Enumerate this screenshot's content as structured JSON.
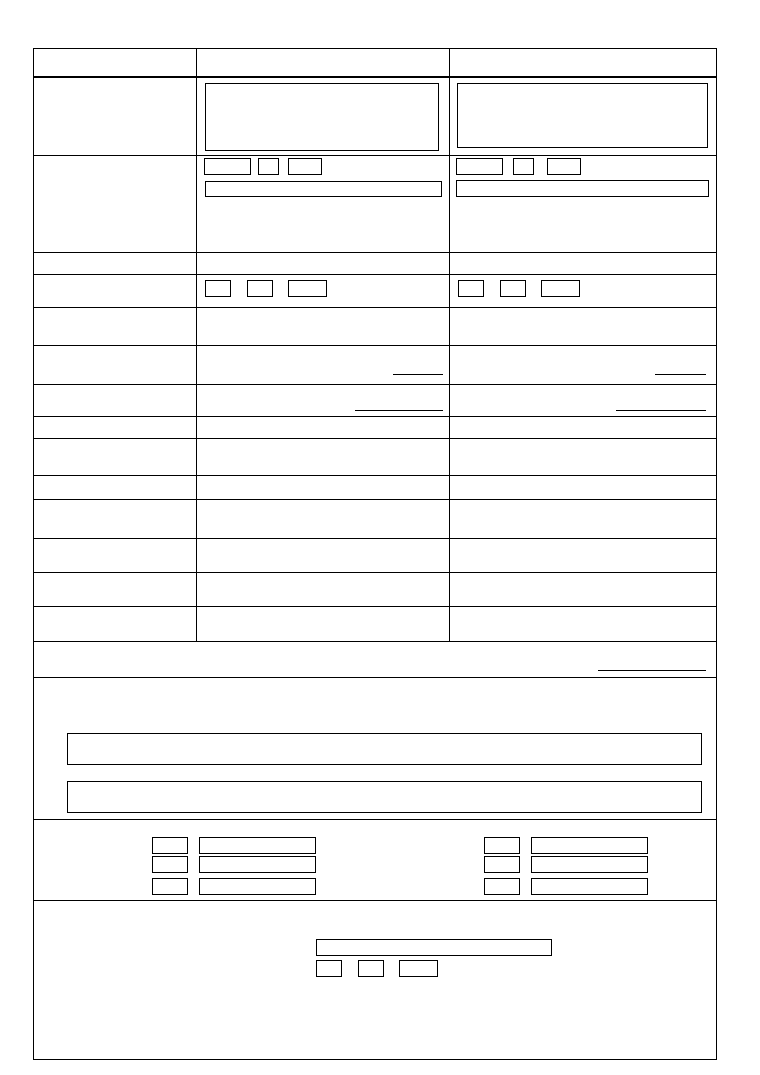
{
  "form": {
    "header": {
      "label_col": "",
      "col_a": "",
      "col_b": ""
    },
    "rows": [
      {
        "label": "",
        "value_a": "",
        "value_b": ""
      },
      {
        "label": "",
        "value_a": "",
        "value_b": ""
      },
      {
        "label": "",
        "value_a": "",
        "value_b": ""
      },
      {
        "label": "",
        "value_a": "",
        "value_b": ""
      },
      {
        "label": "",
        "value_a": "",
        "value_b": ""
      },
      {
        "label": "",
        "value_a": "",
        "value_b": ""
      },
      {
        "label": "",
        "value_a": "",
        "value_b": ""
      },
      {
        "label": "",
        "value_a": "",
        "value_b": ""
      },
      {
        "label": "",
        "value_a": "",
        "value_b": ""
      },
      {
        "label": "",
        "value_a": "",
        "value_b": ""
      },
      {
        "label": "",
        "value_a": "",
        "value_b": ""
      },
      {
        "label": "",
        "value_a": "",
        "value_b": ""
      },
      {
        "label": "",
        "value_a": "",
        "value_b": ""
      },
      {
        "label": "",
        "value_a": "",
        "value_b": ""
      }
    ],
    "total_row": {
      "label": "",
      "value": ""
    },
    "declaration": {
      "text": "",
      "field_1": "",
      "field_2": ""
    },
    "codes": [
      {
        "code": "",
        "value": ""
      },
      {
        "code": "",
        "value": ""
      },
      {
        "code": "",
        "value": ""
      },
      {
        "code": "",
        "value": ""
      },
      {
        "code": "",
        "value": ""
      },
      {
        "code": "",
        "value": ""
      }
    ],
    "signature": {
      "label": "",
      "name": "",
      "day": "",
      "month": "",
      "year": ""
    }
  }
}
